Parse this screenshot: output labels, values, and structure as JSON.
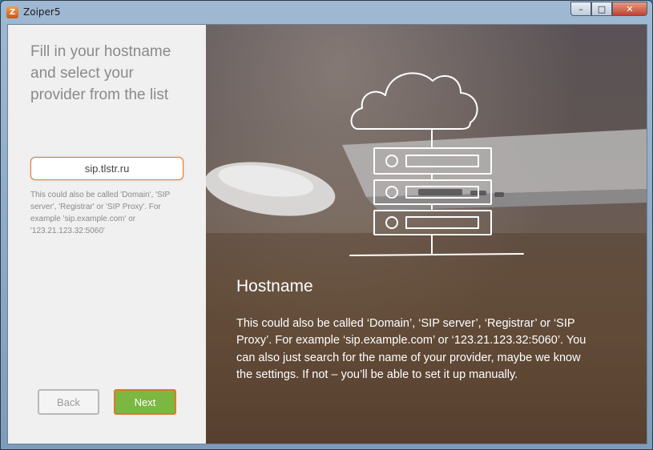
{
  "window": {
    "title": "Zoiper5",
    "icon": "zoiper-icon",
    "controls": {
      "minimize": "–",
      "maximize": "□",
      "close": "✕"
    }
  },
  "left": {
    "heading": "Fill in your hostname and select your provider from the list",
    "hostname_value": "sip.tlstr.ru",
    "hint": "This could also be called 'Domain', 'SIP server', 'Registrar' or 'SIP Proxy'. For example 'sip.example.com' or '123.21.123.32:5060'",
    "back_label": "Back",
    "next_label": "Next"
  },
  "hero": {
    "title": "Hostname",
    "text": "This could also be called ‘Domain’, ‘SIP server’, ‘Registrar’ or ‘SIP Proxy’. For example ‘sip.example.com’ or ‘123.21.123.32:5060’. You can also just search for the name of your provider, maybe we know the settings. If not – you’ll be able to set it up manually.",
    "illustration": "cloud-server-icon"
  },
  "colors": {
    "accent_orange": "#e0762f",
    "next_green": "#7cb742"
  }
}
